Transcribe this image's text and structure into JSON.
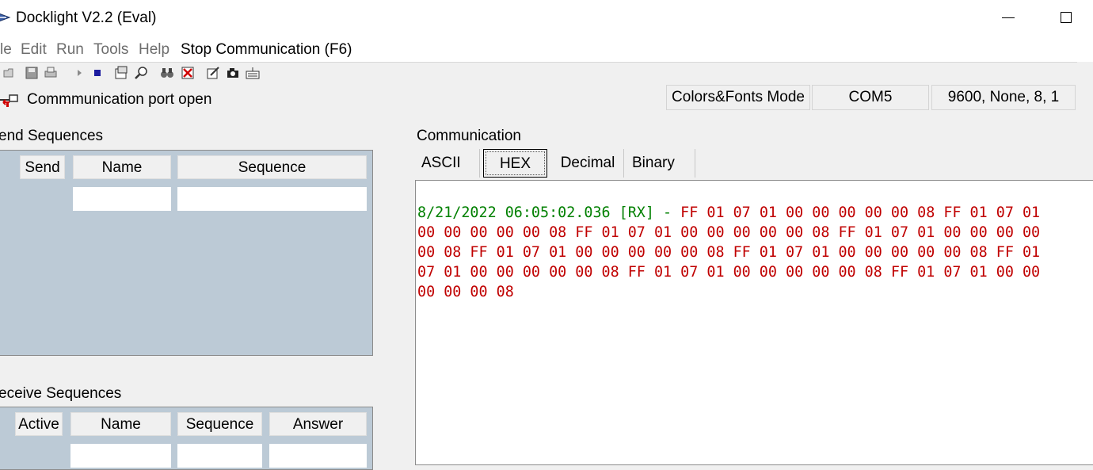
{
  "window": {
    "title": "Docklight V2.2 (Eval)",
    "icons": {
      "app": "docklight-app-icon",
      "minimize": "minimize-icon",
      "maximize": "maximize-icon"
    }
  },
  "menu": {
    "items": [
      "le",
      "Edit",
      "Run",
      "Tools",
      "Help"
    ],
    "stop_label": "Stop Communication  (F6)"
  },
  "toolbar": {
    "icons": [
      "open-folder-icon",
      "save-icon",
      "print-icon",
      "play-icon",
      "stop-icon",
      "settings-icon",
      "zoom-icon",
      "binoculars-icon",
      "clear-icon",
      "edit-icon",
      "snapshot-icon",
      "keyboard-icon"
    ]
  },
  "status": {
    "message": "Commmunication port open",
    "mode": "Colors&Fonts Mode",
    "port": "COM5",
    "settings": "9600, None, 8, 1"
  },
  "send": {
    "label": "end Sequences",
    "columns": [
      "Send",
      "Name",
      "Sequence"
    ]
  },
  "receive": {
    "label": "eceive Sequences",
    "columns": [
      "Active",
      "Name",
      "Sequence",
      "Answer"
    ]
  },
  "communication": {
    "label": "Communication",
    "tabs": [
      "ASCII",
      "HEX",
      "Decimal",
      "Binary"
    ],
    "active_tab": "HEX",
    "timestamp": "8/21/2022 06:05:02.036 [RX] - ",
    "lines": [
      "FF 01 07 01 00 00 00 00 00 08 FF 01 07 01",
      "00 00 00 00 00 08 FF 01 07 01 00 00 00 00 00 08 FF 01 07 01 00 00 00 00",
      "00 08 FF 01 07 01 00 00 00 00 00 08 FF 01 07 01 00 00 00 00 00 08 FF 01",
      "07 01 00 00 00 00 00 08 FF 01 07 01 00 00 00 00 00 08 FF 01 07 01 00 00",
      "00 00 00 08"
    ]
  },
  "colors": {
    "rx_data": "#c00000",
    "timestamp": "#008000",
    "grid_bg": "#bccad6"
  }
}
